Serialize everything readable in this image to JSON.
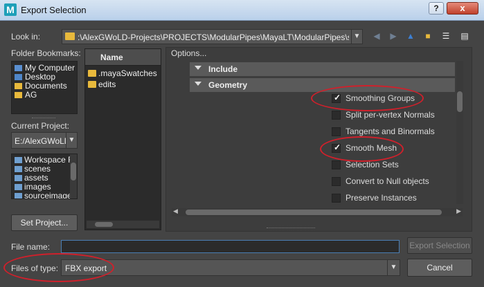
{
  "window": {
    "title": "Export Selection",
    "logo_letter": "M",
    "help_label": "?",
    "close_label": "x"
  },
  "look_in": {
    "label": "Look in:",
    "path": ":\\AlexGWoLD-Projects\\PROJECTS\\ModularPipes\\MayaLT\\ModularPipes\\scenes"
  },
  "bookmarks": {
    "label": "Folder Bookmarks:",
    "items": [
      {
        "label": "My Computer",
        "icon": "computer-icon"
      },
      {
        "label": "Desktop",
        "icon": "desktop-icon"
      },
      {
        "label": "Documents",
        "icon": "documents-icon"
      },
      {
        "label": "AG",
        "icon": "folder-icon"
      }
    ]
  },
  "project": {
    "label": "Current Project:",
    "value": "E:/AlexGWoLD",
    "items": [
      "Workspace R",
      "scenes",
      "assets",
      "images",
      "sourceimage"
    ],
    "set_button": "Set Project..."
  },
  "file_list": {
    "header": "Name",
    "items": [
      ".mayaSwatches",
      "edits"
    ]
  },
  "options": {
    "label": "Options...",
    "sections": [
      "Include",
      "Geometry"
    ],
    "checkboxes": [
      {
        "label": "Smoothing Groups",
        "checked": true
      },
      {
        "label": "Split per-vertex Normals",
        "checked": false
      },
      {
        "label": "Tangents and Binormals",
        "checked": false
      },
      {
        "label": "Smooth Mesh",
        "checked": true
      },
      {
        "label": "Selection Sets",
        "checked": false
      },
      {
        "label": "Convert to Null objects",
        "checked": false
      },
      {
        "label": "Preserve Instances",
        "checked": false
      }
    ]
  },
  "bottom": {
    "file_name_label": "File name:",
    "file_name_value": "",
    "files_of_type_label": "Files of type:",
    "files_of_type_value": "FBX export",
    "export_button": "Export Selection",
    "cancel_button": "Cancel"
  },
  "colors": {
    "annotation": "#d0202b",
    "panel": "#444444",
    "field": "#2b2b2b",
    "folder": "#e8b93c"
  }
}
